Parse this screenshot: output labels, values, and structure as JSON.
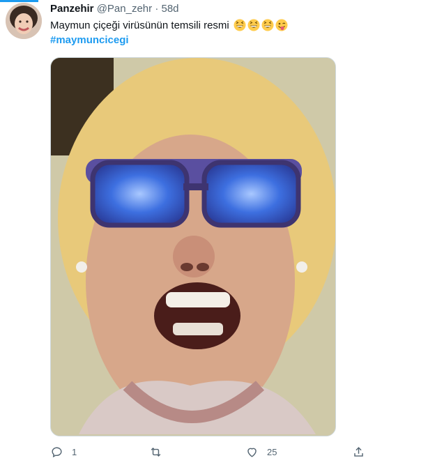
{
  "tweet": {
    "display_name": "Panzehir",
    "handle": "@Pan_zehr",
    "separator": "·",
    "time": "58d",
    "text": "Maymun çiçeği virüsünün temsili resmi",
    "emojis": [
      "grinning-squint-face-icon",
      "grinning-squint-face-icon",
      "grinning-squint-face-icon",
      "winking-tongue-face-icon"
    ],
    "hashtag": "#maymuncicegi"
  },
  "actions": {
    "reply_count": "1",
    "retweet_count": "",
    "like_count": "25"
  },
  "colors": {
    "accent": "#1d9bf0",
    "text": "#0f1419",
    "secondary": "#536471",
    "border": "#cfd9de"
  }
}
